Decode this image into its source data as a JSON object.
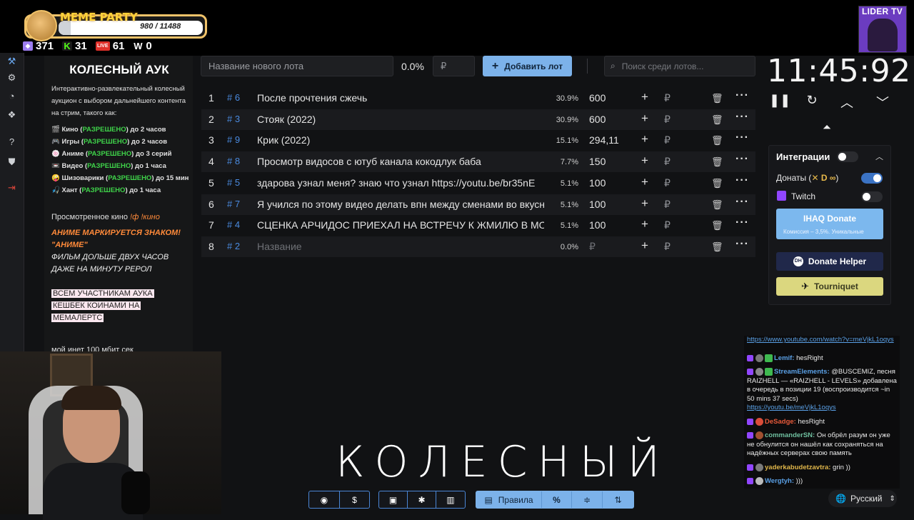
{
  "meme_party": {
    "title": "MEME PARTY",
    "progress_text": "980 / 11488",
    "progress_fraction": 0.085
  },
  "stats": [
    {
      "icon": "points-icon",
      "value": "371",
      "color": "#9d7df0"
    },
    {
      "icon": "kick-icon",
      "value": "31",
      "color": "#53fc18"
    },
    {
      "icon": "live-icon",
      "value": "61",
      "color": "#e0302a"
    },
    {
      "icon": "wins-icon",
      "value": "0",
      "color": "#dddddd"
    }
  ],
  "channel_badge": "LIDER TV",
  "description": {
    "title": "КОЛЕСНЫЙ АУК",
    "intro": "Интерактивно-развлекательный колесный аукцион с выбором дальнейшего контента на стрим, такого как:",
    "allowed": "РАЗРЕШЕНО",
    "items": [
      {
        "icon": "🎬",
        "prefix": "Кино (",
        "suffix": ") до 2 часов"
      },
      {
        "icon": "🎮",
        "prefix": "Игры (",
        "suffix": ") до 2 часов"
      },
      {
        "icon": "🍥",
        "prefix": "Аниме (",
        "suffix": ") до 3 серий"
      },
      {
        "icon": "📼",
        "prefix": "Видео (",
        "suffix": ") до 1 часа"
      },
      {
        "icon": "🤪",
        "prefix": "Шизоварики (",
        "suffix": ") до 15 мин"
      },
      {
        "icon": "🎣",
        "prefix": "Хант (",
        "suffix": ") до 1 часа"
      }
    ],
    "watched_label": "Просмотренное кино",
    "watched_cmd": "!ф !кино",
    "anime_note": "АНИМЕ МАРКИРУЕТСЯ ЗНАКОМ! \"АНИМЕ\"",
    "film_note": "ФИЛЬМ ДОЛЬШЕ ДВУХ ЧАСОВ ДАЖЕ НА МИНУТУ РЕРОЛ",
    "cashback_1": "ВСЕМ УЧАСТНИКАМ АУКА",
    "cashback_2": "КЕШБЕК КОИНАМИ НА",
    "cashback_3": "МЕМАЛЕРТС",
    "internet": "мой инет 100 мбит сек"
  },
  "lot_form": {
    "name_placeholder": "Название нового лота",
    "percent": "0.0%",
    "currency": "₽",
    "add_label": "Добавить лот",
    "search_placeholder": "Поиск среди лотов..."
  },
  "lots": [
    {
      "n": "1",
      "id": "# 6",
      "name": "После прочтения сжечь",
      "pct": "30.9%",
      "amount": "600"
    },
    {
      "n": "2",
      "id": "# 3",
      "name": "Стояк (2022)",
      "pct": "30.9%",
      "amount": "600"
    },
    {
      "n": "3",
      "id": "# 9",
      "name": "Крик (2022)",
      "pct": "15.1%",
      "amount": "294,11"
    },
    {
      "n": "4",
      "id": "# 8",
      "name": "Просмотр видосов с ютуб канала кокодлук баба",
      "pct": "7.7%",
      "amount": "150"
    },
    {
      "n": "5",
      "id": "# 5",
      "name": "здарова узнал меня? знаю что узнал https://youtu.be/br35nE",
      "pct": "5.1%",
      "amount": "100"
    },
    {
      "n": "6",
      "id": "# 7",
      "name": "Я учился по этому видео делать впн между сменами во вкусно",
      "pct": "5.1%",
      "amount": "100"
    },
    {
      "n": "7",
      "id": "# 4",
      "name": "СЦЕНКА АРЧИДОС ПРИЕХАЛ НА ВСТРЕЧУ К ЖМИЛЮ В МОСКВУ",
      "pct": "5.1%",
      "amount": "100"
    },
    {
      "n": "8",
      "id": "# 2",
      "name": "Название",
      "pct": "0.0%",
      "amount": "₽",
      "empty": true
    }
  ],
  "timer": "11:45:92",
  "integrations": {
    "title": "Интеграции",
    "donaty": "Донаты (",
    "donaty_close": ")",
    "twitch": "Twitch",
    "ihaq_label": "IHAQ Donate",
    "ihaq_sub": "Комиссия – 3,5%. Уникальные",
    "dh_label": "Donate Helper",
    "tq_label": "Tourniquet"
  },
  "chat": {
    "m0": "https://www.youtube.com/watch?v=meVjkL1oqys",
    "m1_user": "Lemif:",
    "m1_text": "hesRight",
    "m2_user": "StreamElements:",
    "m2_text": "@BUSCEMIZ, песня RAIZHELL — «RAIZHELL - LEVELS» добавлена в очередь в позиции 19 (воспроизводится ~in 50 mins 37 secs)",
    "m2_link": "https://youtu.be/meVjkL1oqys",
    "m3_user": "DeSadge:",
    "m3_text": "hesRight",
    "m4_user": "commanderSN:",
    "m4_text": "Он обрёл разум он уже не обнулится он нашёл как сохраняться на надёжных серверах свою память",
    "m5_user": "yaderkabudetzavtra:",
    "m5_text": "grin ))",
    "m6_user": "Wergtyh:",
    "m6_text": ")))"
  },
  "overlay_text": "КОЛЕСНЫЙ",
  "toolbar": {
    "rules_label": "Правила"
  },
  "language": "Русский"
}
